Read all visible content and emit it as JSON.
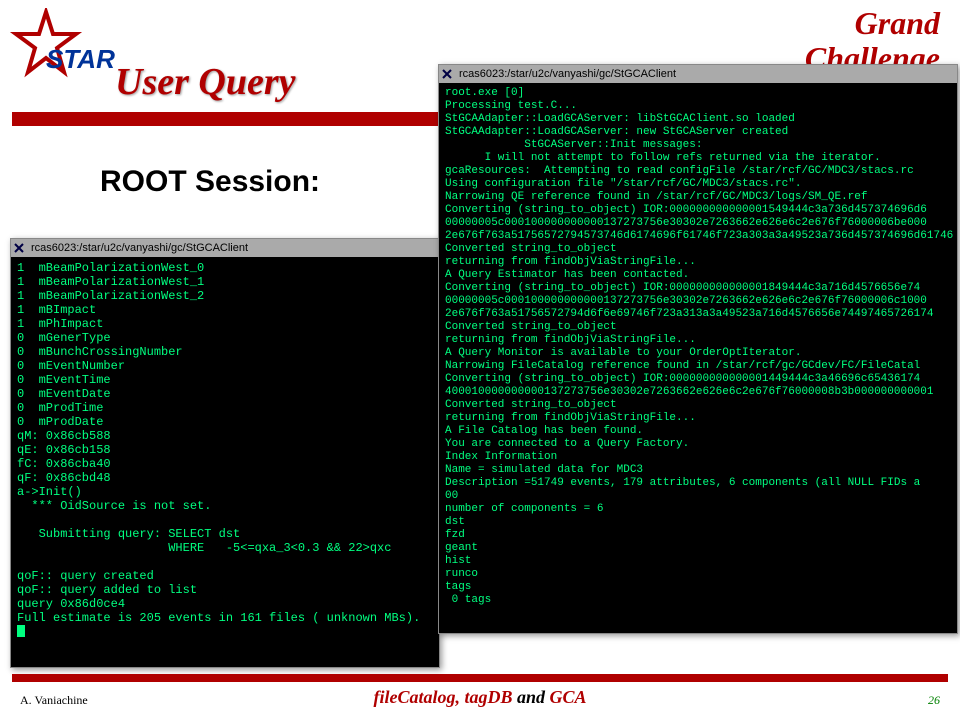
{
  "titles": {
    "slide": "User Query",
    "grand1": "Grand",
    "grand2": "Challenge",
    "subtitle": "ROOT Session:"
  },
  "logo": {
    "text": "STAR"
  },
  "terminal1": {
    "title": "rcas6023:/star/u2c/vanyashi/gc/StGCAClient",
    "lines": [
      "1  mBeamPolarizationWest_0",
      "1  mBeamPolarizationWest_1",
      "1  mBeamPolarizationWest_2",
      "1  mBImpact",
      "1  mPhImpact",
      "0  mGenerType",
      "0  mBunchCrossingNumber",
      "0  mEventNumber",
      "0  mEventTime",
      "0  mEventDate",
      "0  mProdTime",
      "0  mProdDate",
      "qM: 0x86cb588",
      "qE: 0x86cb158",
      "fC: 0x86cba40",
      "qF: 0x86cbd48",
      "a->Init()",
      "  *** OidSource is not set.",
      "",
      "   Submitting query: SELECT dst",
      "                     WHERE   -5<=qxa_3<0.3 && 22>qxc",
      "",
      "qoF:: query created",
      "qoF:: query added to list",
      "query 0x86d0ce4",
      "Full estimate is 205 events in 161 files ( unknown MBs)."
    ]
  },
  "terminal2": {
    "title": "rcas6023:/star/u2c/vanyashi/gc/StGCAClient",
    "lines": [
      "root.exe [0]",
      "Processing test.C...",
      "StGCAAdapter::LoadGCAServer: libStGCAClient.so loaded",
      "StGCAAdapter::LoadGCAServer: new StGCAServer created",
      "            StGCAServer::Init messages:",
      "      I will not attempt to follow refs returned via the iterator.",
      "gcaResources:  Attempting to read configFile /star/rcf/GC/MDC3/stacs.rc",
      "Using configuration file \"/star/rcf/GC/MDC3/stacs.rc\".",
      "Narrowing QE reference found in /star/rcf/GC/MDC3/logs/SM_QE.ref",
      "Converting (string_to_object) IOR:000000000000001549444c3a736d457374696d6",
      "00000005c000100000000000137273756e30302e7263662e626e6c2e676f76000006be000",
      "2e676f763a51756572794573746d6174696f61746f723a303a3a49523a736d457374696d61746",
      "Converted string_to_object",
      "returning from findObjViaStringFile...",
      "A Query Estimator has been contacted.",
      "Converting (string_to_object) IOR:000000000000001849444c3a716d4576656e74",
      "00000005c000100000000000137273756e30302e7263662e626e6c2e676f76000006c1000",
      "2e676f763a51756572794d6f6e69746f723a313a3a49523a716d4576656e74497465726174",
      "Converted string_to_object",
      "returning from findObjViaStringFile...",
      "A Query Monitor is available to your OrderOptIterator.",
      "Narrowing FileCatalog reference found in /star/rcf/gc/GCdev/FC/FileCatal",
      "Converting (string_to_object) IOR:000000000000001449444c3a46696c65436174",
      "400010000000000137273756e30302e7263662e626e6c2e676f76000008b3b000000000001",
      "Converted string_to_object",
      "returning from findObjViaStringFile...",
      "A File Catalog has been found.",
      "You are connected to a Query Factory.",
      "Index Information",
      "Name = simulated data for MDC3",
      "Description =51749 events, 179 attributes, 6 components (all NULL FIDs a",
      "00",
      "number of components = 6",
      "dst",
      "fzd",
      "geant",
      "hist",
      "runco",
      "tags",
      " 0 tags"
    ]
  },
  "footer": {
    "left": "A. Vaniachine",
    "center_a": "fileCatalog, tagDB",
    "center_b": " and ",
    "center_c": "GCA",
    "right": "26"
  }
}
